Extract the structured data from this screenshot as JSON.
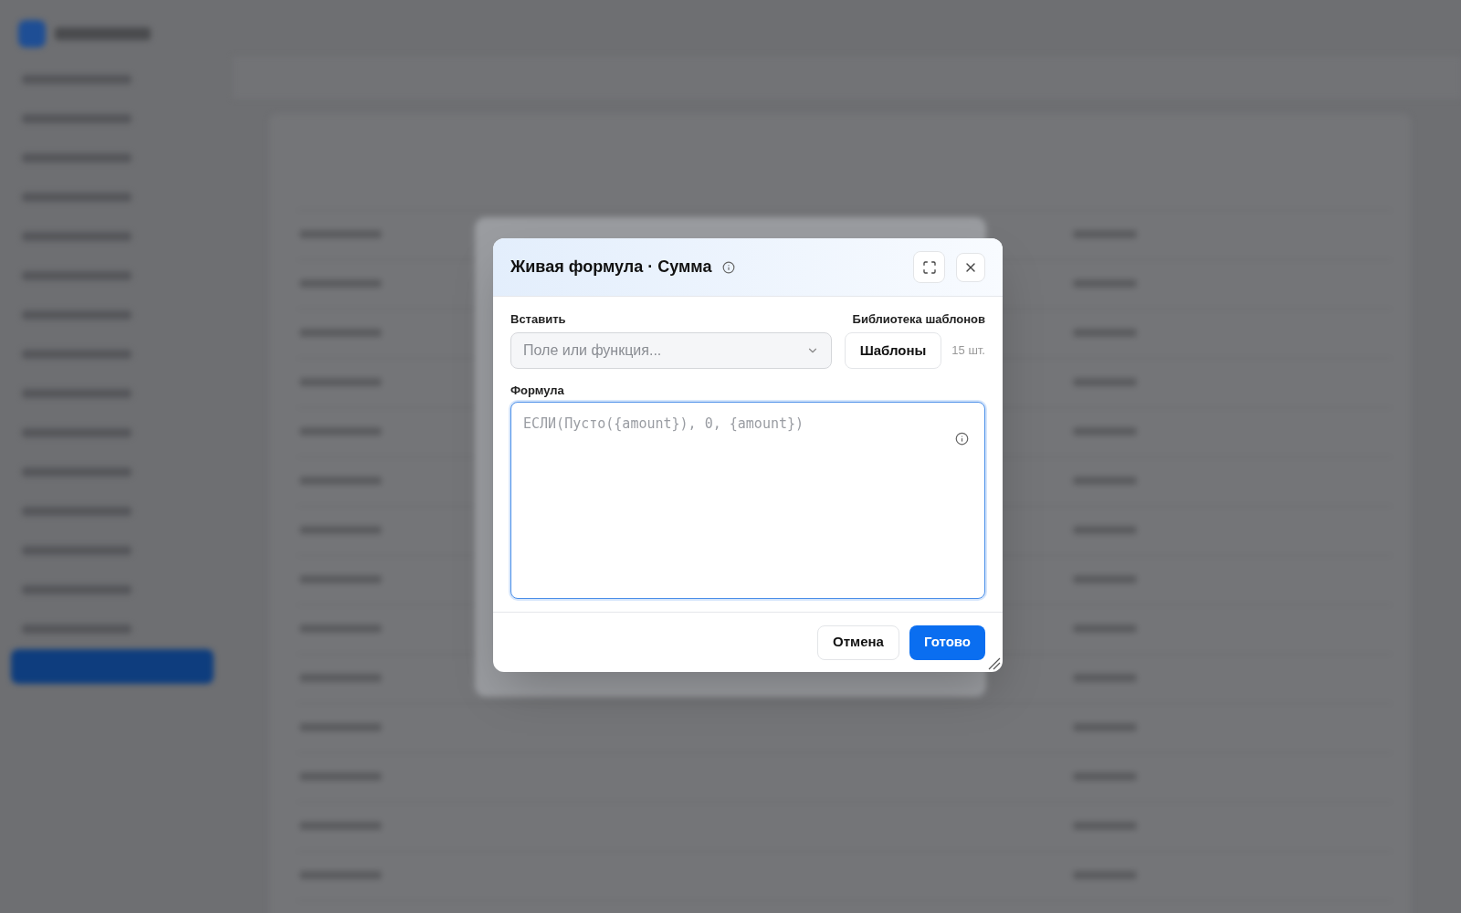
{
  "dialog": {
    "title": "Живая формула · Сумма",
    "insert": {
      "label": "Вставить",
      "placeholder": "Поле или функция..."
    },
    "templates": {
      "label": "Библиотека шаблонов",
      "button": "Шаблоны",
      "count": "15 шт."
    },
    "formula": {
      "label": "Формула",
      "placeholder": "ЕСЛИ(Пусто({amount}), 0, {amount})",
      "focused": true
    },
    "buttons": [
      {
        "label": "Отмена",
        "kind": "secondary"
      },
      {
        "label": "Готово",
        "kind": "primary"
      }
    ]
  }
}
